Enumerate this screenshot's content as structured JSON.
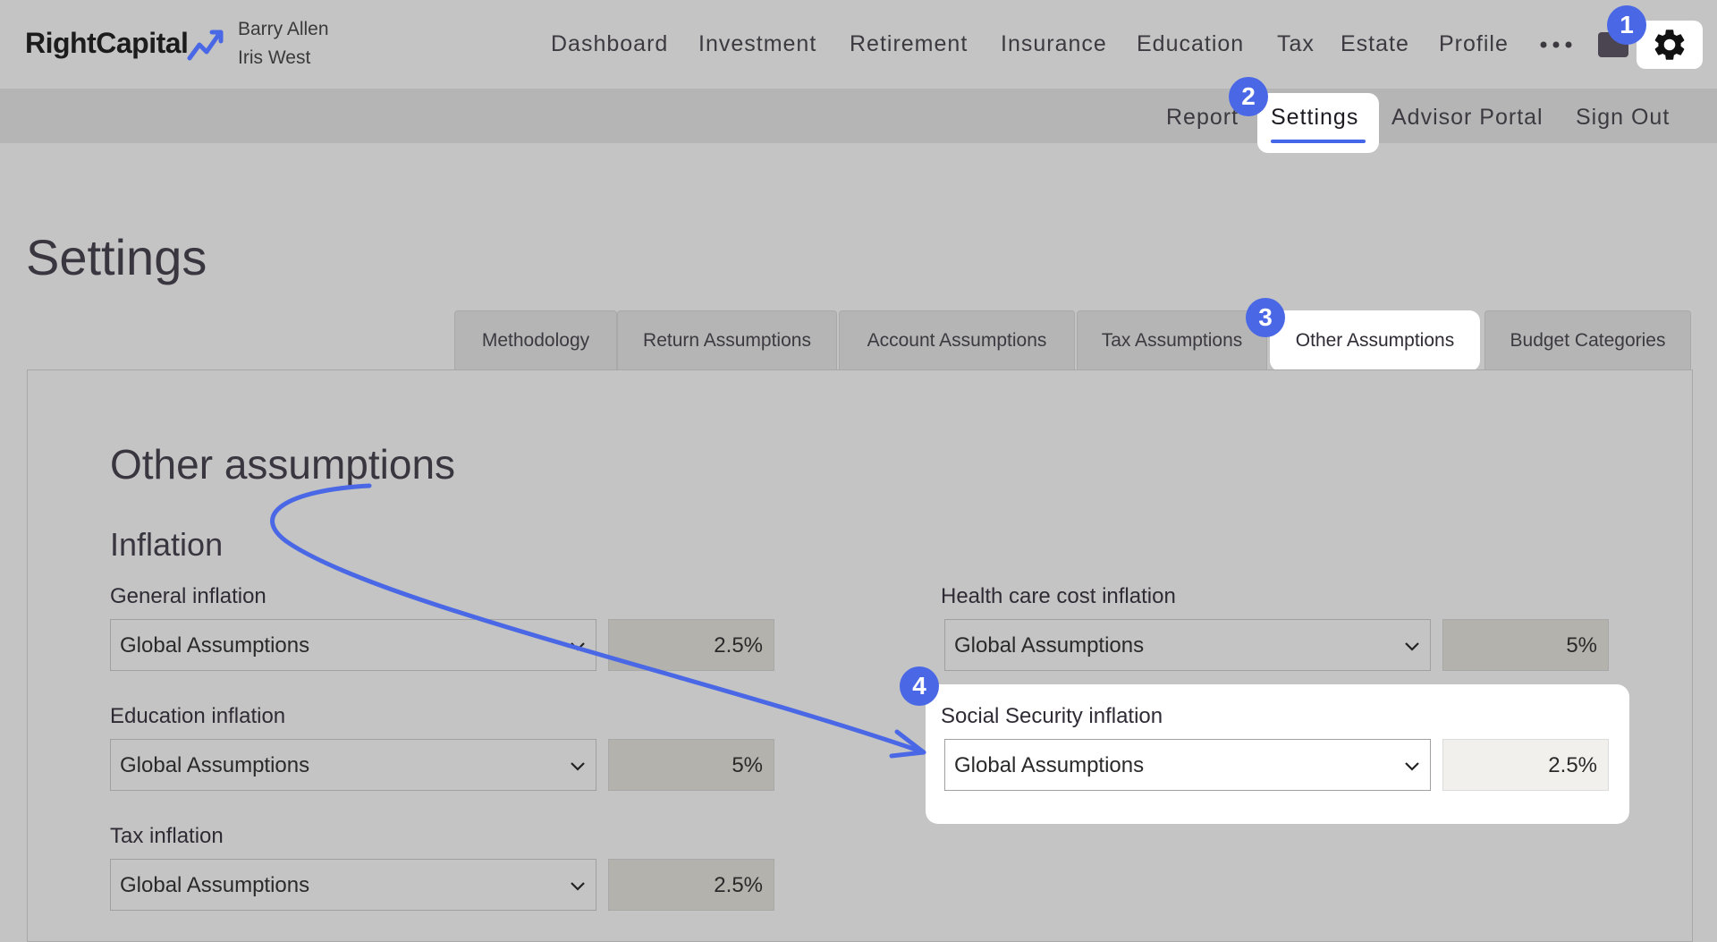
{
  "brand": {
    "name": "RightCapital",
    "accent": "#4a68e6"
  },
  "client": {
    "primary": "Barry Allen",
    "spouse": "Iris West"
  },
  "nav": {
    "items": [
      "Dashboard",
      "Investment",
      "Retirement",
      "Insurance",
      "Education",
      "Tax",
      "Estate",
      "Profile"
    ],
    "more_icon": "ellipsis-icon",
    "folder_icon": "folder-icon",
    "settings_icon": "gear-icon"
  },
  "subnav": {
    "items": [
      "Report",
      "Settings",
      "Advisor Portal",
      "Sign Out"
    ],
    "active": "Settings"
  },
  "page": {
    "title": "Settings"
  },
  "tabs": {
    "items": [
      "Methodology",
      "Return Assumptions",
      "Account Assumptions",
      "Tax Assumptions",
      "Other Assumptions",
      "Budget Categories"
    ],
    "active": "Other Assumptions"
  },
  "content": {
    "heading": "Other assumptions",
    "section": "Inflation",
    "fields": {
      "general": {
        "label": "General inflation",
        "source": "Global Assumptions",
        "value": "2.5%"
      },
      "education": {
        "label": "Education inflation",
        "source": "Global Assumptions",
        "value": "5%"
      },
      "tax": {
        "label": "Tax inflation",
        "source": "Global Assumptions",
        "value": "2.5%"
      },
      "health": {
        "label": "Health care cost inflation",
        "source": "Global Assumptions",
        "value": "5%"
      },
      "social_security": {
        "label": "Social Security inflation",
        "source": "Global Assumptions",
        "value": "2.5%"
      }
    }
  },
  "annotations": {
    "step1": "1",
    "step2": "2",
    "step3": "3",
    "step4": "4"
  }
}
